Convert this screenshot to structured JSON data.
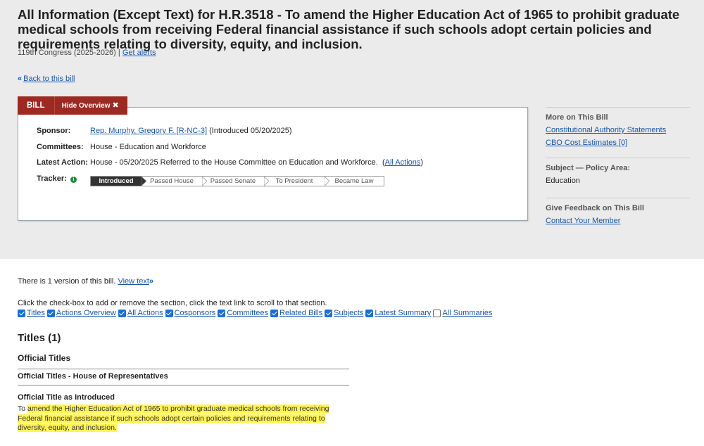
{
  "header": {
    "title": "All Information (Except Text) for H.R.3518 - To amend the Higher Education Act of 1965 to prohibit graduate medical schools from receiving Federal financial assistance if such schools adopt certain policies and requirements relating to diversity, equity, and inclusion.",
    "congress": "119th Congress (2025-2026)",
    "separator": "|",
    "alerts_link": "Get alerts",
    "back_icon": "«",
    "back_link": "Back to this bill"
  },
  "tabs": {
    "bill": "BILL",
    "hide_overview": "Hide Overview",
    "close_glyph": "✖"
  },
  "overview": {
    "sponsor_label": "Sponsor:",
    "sponsor_name": "Rep. Murphy, Gregory F. [R-NC-3]",
    "sponsor_intro": "(Introduced 05/20/2025)",
    "committees_label": "Committees:",
    "committees_value": "House - Education and Workforce",
    "latest_label": "Latest Action:",
    "latest_value": "House - 05/20/2025 Referred to the House Committee on Education and Workforce.",
    "all_actions_link": "All Actions",
    "tracker_label": "Tracker:",
    "tracker_info_glyph": "i",
    "tracker_steps": [
      "Introduced",
      "Passed House",
      "Passed Senate",
      "To President",
      "Became Law"
    ],
    "tracker_active_index": 0
  },
  "sidebar": {
    "more_heading": "More on This Bill",
    "constitutional_link": "Constitutional Authority Statements",
    "cbo_link": "CBO Cost Estimates [0]",
    "subject_heading": "Subject — Policy Area:",
    "subject_value": "Education",
    "feedback_heading": "Give Feedback on This Bill",
    "contact_link": "Contact Your Member"
  },
  "main": {
    "versions_text": "There is 1 version of this bill.",
    "view_text_link": "View text",
    "view_text_icon": "»",
    "instructions": "Click the check-box to add or remove the section, click the text link to scroll to that section.",
    "sections": [
      {
        "label": "Titles",
        "checked": true
      },
      {
        "label": "Actions Overview",
        "checked": true
      },
      {
        "label": "All Actions",
        "checked": true
      },
      {
        "label": "Cosponsors",
        "checked": true
      },
      {
        "label": "Committees",
        "checked": true
      },
      {
        "label": "Related Bills",
        "checked": true
      },
      {
        "label": "Subjects",
        "checked": true
      },
      {
        "label": "Latest Summary",
        "checked": true
      },
      {
        "label": "All Summaries",
        "checked": false
      }
    ],
    "titles_heading": "Titles (1)",
    "official_titles_heading": "Official Titles",
    "house_heading": "Official Titles - House of Representatives",
    "introduced_heading": "Official Title as Introduced",
    "title_prefix": "To",
    "title_highlight": "amend the Higher Education Act of 1965 to prohibit graduate medical schools from receiving Federal financial assistance if such schools adopt certain policies and requirements relating to diversity, equity, and inclusion."
  },
  "colors": {
    "tab_red": "#9c2a22",
    "link_blue": "#1a56a8",
    "highlight_yellow": "#fff455",
    "tracker_active": "#333333",
    "info_green": "#1f8a3d"
  }
}
